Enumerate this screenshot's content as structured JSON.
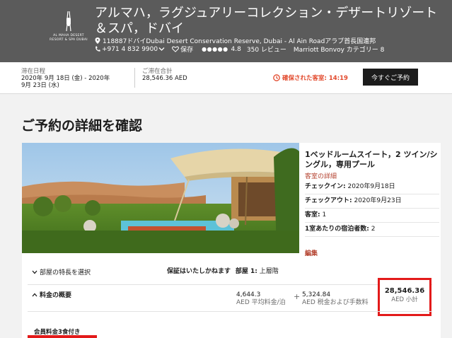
{
  "header": {
    "logo_text": "AL MAHA DESERT RESORT & SPA DUBAI",
    "hotel_name": "アルマハ，ラグジュアリーコレクション・デザートリゾート＆スパ，ドバイ",
    "address": "118887ドバイDubai Desert Conservation Reserve, Dubai - Al Ain Roadアラブ首長国連邦",
    "phone": "+971 4 832 9900",
    "save_label": "保存",
    "rating": "4.8",
    "reviews": "350 レビュー",
    "category": "Marriott Bonvoy カテゴリー 8"
  },
  "stay": {
    "dates_label": "滞在日程",
    "dates_line1": "2020年 9月 18日 (金) - 2020年",
    "dates_line2": "9月 23日 (水)",
    "total_label": "ご滞在合計",
    "total_value": "28,546.36 AED",
    "confirmed": "確保された客室: 14:19",
    "book_button": "今すぐご予約"
  },
  "main": {
    "title": "ご予約の詳細を確認",
    "room_title": "1ベッドルームスイート，2 ツイン/シングル，専用プール",
    "room_details_link": "客室の詳細",
    "checkin_label": "チェックイン:",
    "checkin_value": "2020年9月18日",
    "checkout_label": "チェックアウト:",
    "checkout_value": "2020年9月23日",
    "guests_label": "客室:",
    "guests_value": "1",
    "occupancy_label": "1室あたりの宿泊者数:",
    "occupancy_value": "2",
    "edit_link": "編集",
    "features_label": "部屋の特長を選択",
    "guarantee_text": "保証はいたしかねます",
    "room_label": "部屋 1:",
    "room_value": "上層階",
    "rate_summary_label": "料金の概要",
    "avg_value": "4,644.3",
    "avg_label": "AED 平均料金/泊",
    "plus": "+",
    "tax_value": "5,324.84",
    "tax_label": "AED 税金および手数料",
    "equals": "=",
    "subtotal_value": "28,546.36",
    "subtotal_label": "AED 小計",
    "member_rate": "会員料金3食付き"
  },
  "colors": {
    "header_bg": "#5b5b5b",
    "accent": "#b4422f",
    "alert": "#e2482b",
    "highlight": "#e31a1a"
  }
}
